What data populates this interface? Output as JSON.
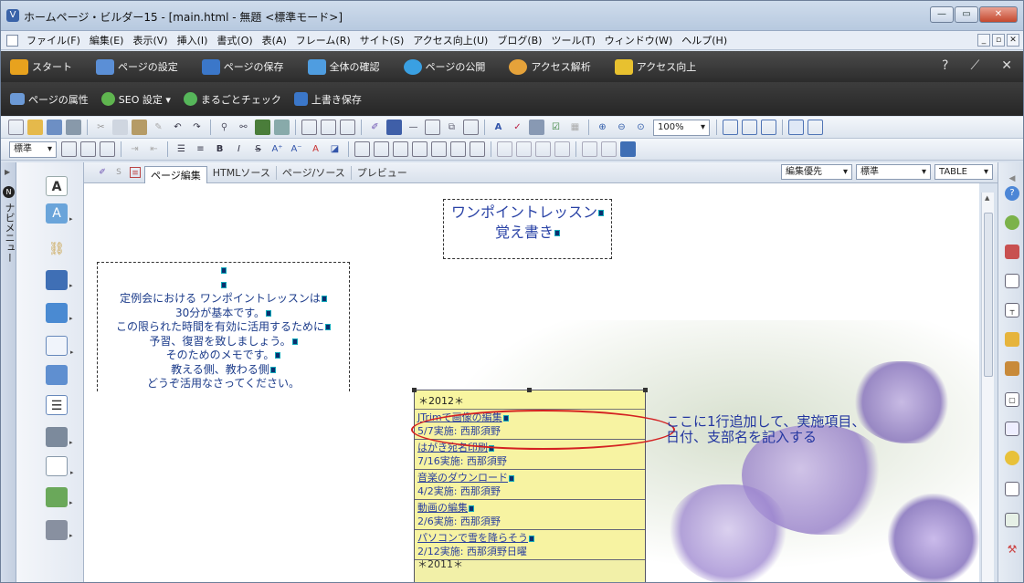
{
  "window": {
    "title": "ホームページ・ビルダー15 - [main.html - 無題 <標準モード>]",
    "app_icon": "V",
    "buttons": {
      "minimize": "—",
      "maximize": "▭",
      "close": "✕"
    }
  },
  "menubar": {
    "items": [
      "ファイル(F)",
      "編集(E)",
      "表示(V)",
      "挿入(I)",
      "書式(O)",
      "表(A)",
      "フレーム(R)",
      "サイト(S)",
      "アクセス向上(U)",
      "ブログ(B)",
      "ツール(T)",
      "ウィンドウ(W)",
      "ヘルプ(H)"
    ],
    "mdi_buttons": [
      "_",
      "▫",
      "✕"
    ]
  },
  "bar1": {
    "start": "スタート",
    "page_settings": "ページの設定",
    "page_save": "ページの保存",
    "check_all": "全体の確認",
    "publish": "ページの公開",
    "analytics": "アクセス解析",
    "access_up": "アクセス向上",
    "right_icons": [
      "?",
      "⟋",
      "✕"
    ]
  },
  "bar2": {
    "page_props": "ページの属性",
    "seo_settings": "SEO 設定 ▾",
    "check_all": "まるごとチェック",
    "overwrite_save": "上書き保存"
  },
  "toolbar": {
    "zoom": "100%",
    "style_combo": "標準"
  },
  "navstrip": {
    "label": "ナビメニュー"
  },
  "tabs": {
    "items": [
      "ページ編集",
      "HTMLソース",
      "ページ/ソース",
      "プレビュー"
    ],
    "active": 0,
    "right_combos": [
      "編集優先",
      "標準",
      "TABLE"
    ]
  },
  "page": {
    "heading_lines": [
      "ワンポイントレッスン",
      "覚え書き"
    ],
    "note_lines": [
      "定例会における ワンポイントレッスンは",
      "30分が基本です。",
      "この限られた時間を有効に活用するために",
      "予習、復習を致しましょう。",
      "そのためのメモです。",
      "教える側、教わる側",
      "どうぞ活用なさってください。"
    ],
    "list": {
      "header": "＊2012＊",
      "items": [
        {
          "title": "JTrimで画像の編集",
          "date": "5/7実施: 西那須野"
        },
        {
          "title": "はがき宛名印刷",
          "date": "7/16実施: 西那須野"
        },
        {
          "title": "音楽のダウンロード",
          "date": "4/2実施: 西那須野"
        },
        {
          "title": "動画の編集",
          "date": "2/6実施: 西那須野"
        },
        {
          "title": "パソコンで雪を降らそう",
          "date": "2/12実施: 西那須野日曜"
        }
      ],
      "footer": "＊2011＊"
    },
    "annotation_lines": [
      "ここに1行追加して、実施項目、",
      "日付、支部名を記入する"
    ]
  },
  "colors": {
    "annotation": "#2336a0",
    "highlight_oval": "#d42222",
    "list_bg": "#f2f0a8"
  }
}
